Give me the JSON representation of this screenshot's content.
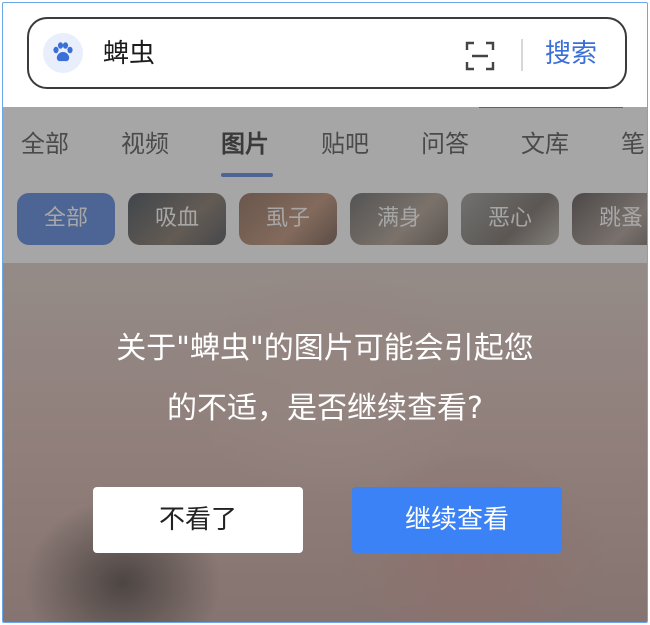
{
  "search": {
    "query": "蜱虫",
    "submit_label": "搜索"
  },
  "tabs": [
    {
      "label": "全部"
    },
    {
      "label": "视频"
    },
    {
      "label": "图片"
    },
    {
      "label": "贴吧"
    },
    {
      "label": "问答"
    },
    {
      "label": "文库"
    },
    {
      "label": "笔"
    }
  ],
  "active_tab": "图片",
  "chips": [
    {
      "label": "全部"
    },
    {
      "label": "吸血"
    },
    {
      "label": "虱子"
    },
    {
      "label": "满身"
    },
    {
      "label": "恶心"
    },
    {
      "label": "跳蚤"
    }
  ],
  "warning": {
    "line1": "关于\"蜱虫\"的图片可能会引起您",
    "line2": "的不适，是否继续查看?"
  },
  "buttons": {
    "cancel_label": "不看了",
    "continue_label": "继续查看"
  },
  "colors": {
    "accent": "#3a6fd8",
    "continue_button": "#3b82f6"
  }
}
